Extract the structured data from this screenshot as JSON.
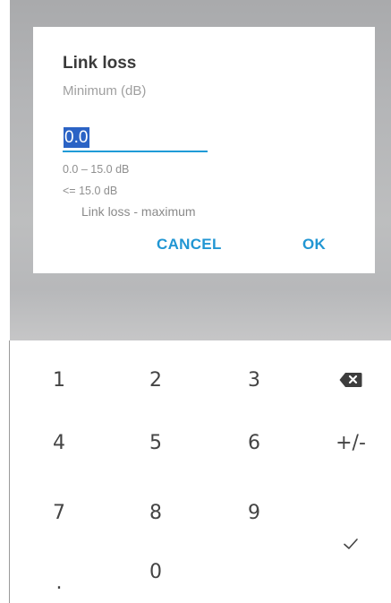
{
  "dialog": {
    "title": "Link loss",
    "subtitle": "Minimum (dB)",
    "input_value": "0.0",
    "hint_range": "0.0 – 15.0 dB",
    "hint_limit": "<= 15.0 dB",
    "hint_reference": "Link loss - maximum",
    "cancel_label": "CANCEL",
    "ok_label": "OK"
  },
  "keypad": {
    "key_1": "1",
    "key_2": "2",
    "key_3": "3",
    "key_4": "4",
    "key_5": "5",
    "key_6": "6",
    "key_7": "7",
    "key_8": "8",
    "key_9": "9",
    "key_0": "0",
    "key_decimal": ".",
    "key_sign": "+/-",
    "backspace_icon": "backspace-icon",
    "done_icon": "checkmark-icon"
  },
  "colors": {
    "accent": "#2196d3",
    "selection": "#2b63c5",
    "title_text": "#3a3a3a",
    "hint_text": "#8f8f8f"
  }
}
